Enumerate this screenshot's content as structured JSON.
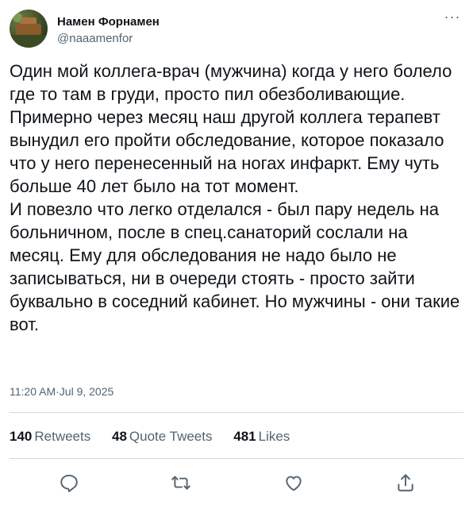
{
  "author": {
    "display_name": "Намен Форнамен",
    "handle": "@naaamenfor"
  },
  "tweet": {
    "text": "Один мой коллега-врач (мужчина) когда у него болело где то там в груди, просто пил обезболивающие. Примерно через месяц наш другой коллега терапевт вынудил его пройти обследование, которое показало что у него перенесенный на ногах инфаркт. Ему чуть больше 40 лет было на тот момент.\nИ повезло что легко отделался - был пару недель на больничном, после в спец.санаторий сослали на месяц. Ему для обследования не надо было не записываться, ни в очереди стоять - просто зайти буквально в соседний кабинет. Но мужчины - они такие вот.",
    "time": "11:20 AM",
    "separator": " · ",
    "date": "Jul 9, 2025"
  },
  "stats": {
    "retweets_count": "140",
    "retweets_label": "Retweets",
    "quote_count": "48",
    "quote_label": "Quote Tweets",
    "likes_count": "481",
    "likes_label": "Likes"
  },
  "icons": {
    "more": "more-icon",
    "reply": "reply-icon",
    "retweet": "retweet-icon",
    "like": "like-icon",
    "share": "share-icon"
  },
  "colors": {
    "text_primary": "#0f1419",
    "text_secondary": "#536471",
    "divider": "#cfd9de"
  }
}
